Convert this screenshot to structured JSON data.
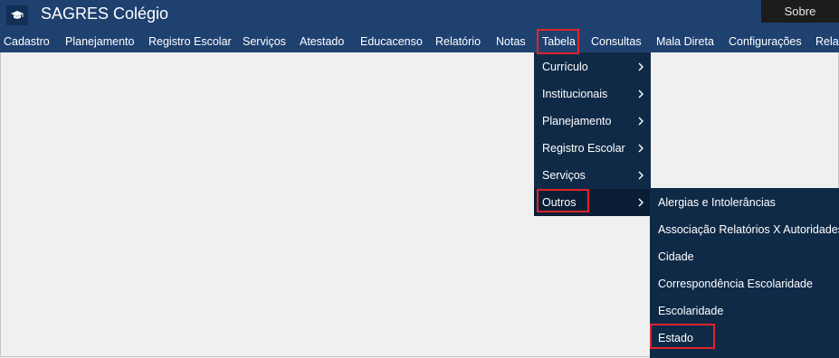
{
  "app": {
    "title": "SAGRES Colégio",
    "sobre_label": "Sobre"
  },
  "menubar": {
    "items": [
      {
        "label": "Cadastro"
      },
      {
        "label": "Planejamento"
      },
      {
        "label": "Registro Escolar"
      },
      {
        "label": "Serviços"
      },
      {
        "label": "Atestado"
      },
      {
        "label": "Educacenso"
      },
      {
        "label": "Relatório"
      },
      {
        "label": "Notas"
      },
      {
        "label": "Tabela"
      },
      {
        "label": "Consultas"
      },
      {
        "label": "Mala Direta"
      },
      {
        "label": "Configurações"
      },
      {
        "label": "Relatórios"
      }
    ]
  },
  "tabela_menu": {
    "items": [
      {
        "label": "Currículo"
      },
      {
        "label": "Institucionais"
      },
      {
        "label": "Planejamento"
      },
      {
        "label": "Registro Escolar"
      },
      {
        "label": "Serviços"
      },
      {
        "label": "Outros"
      }
    ]
  },
  "outros_menu": {
    "items": [
      {
        "label": "Alergias e Intolerâncias"
      },
      {
        "label": "Associação Relatórios X Autoridades"
      },
      {
        "label": "Cidade"
      },
      {
        "label": "Correspondência Escolaridade"
      },
      {
        "label": "Escolaridade"
      },
      {
        "label": "Estado"
      }
    ]
  },
  "colors": {
    "header_bg": "#1f4170",
    "menu_bg": "#0f2a47",
    "highlight": "#e0232a"
  }
}
